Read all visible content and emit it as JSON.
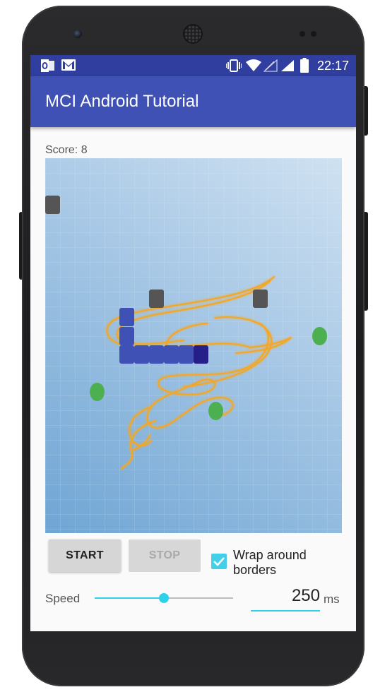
{
  "status_bar": {
    "time": "22:17",
    "left_icons": [
      "outlook-icon",
      "gmail-icon"
    ],
    "right_icons": [
      "vibrate-icon",
      "wifi-icon",
      "signal-empty-icon",
      "signal-icon",
      "battery-icon"
    ]
  },
  "app_bar": {
    "title": "MCI Android Tutorial"
  },
  "game": {
    "score_label": "Score:",
    "score_value": "8",
    "snake_color": "#3f51b5",
    "snake_head_color": "#261f8a",
    "obstacle_color": "#555555",
    "food_color": "#4caf50",
    "background_illustration": "snake-outline-illustration"
  },
  "controls": {
    "start_label": "START",
    "stop_label": "STOP",
    "stop_enabled": false,
    "wrap_checkbox_checked": true,
    "wrap_label": "Wrap around borders",
    "speed_label": "Speed",
    "speed_slider_fraction": 0.5,
    "speed_value": "250",
    "speed_unit": "ms",
    "accent_color": "#2fd0eb"
  },
  "colors": {
    "primary": "#3f51b5",
    "primary_dark": "#303f9f"
  }
}
